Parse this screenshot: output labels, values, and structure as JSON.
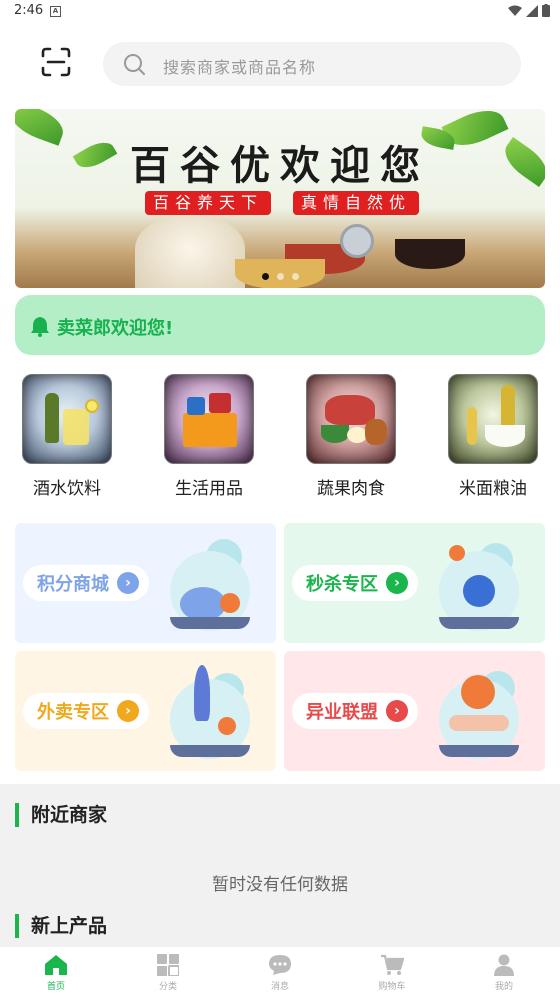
{
  "status_bar": {
    "time": "2:46"
  },
  "search": {
    "placeholder": "搜索商家或商品名称"
  },
  "banner": {
    "title": "百谷优欢迎您",
    "tag_left": "百谷养天下",
    "tag_right": "真情自然优",
    "slide_count": 3,
    "active_slide": 1
  },
  "notice": {
    "text": "卖菜郎欢迎您!"
  },
  "categories": [
    {
      "label": "酒水饮料",
      "icon": "drinks-icon"
    },
    {
      "label": "生活用品",
      "icon": "daily-goods-icon"
    },
    {
      "label": "蔬果肉食",
      "icon": "meat-produce-icon"
    },
    {
      "label": "米面粮油",
      "icon": "grain-oil-icon"
    }
  ],
  "promo_cards": [
    {
      "label": "积分商城",
      "color": "#7fa3e8",
      "bg": "#eef4ff",
      "icon": "piggy-bank-icon"
    },
    {
      "label": "秒杀专区",
      "color": "#1bb54e",
      "bg": "#e4f8ee",
      "icon": "stopwatch-icon"
    },
    {
      "label": "外卖专区",
      "color": "#f0a81c",
      "bg": "#fff5e4",
      "icon": "rocket-icon"
    },
    {
      "label": "异业联盟",
      "color": "#e84a4a",
      "bg": "#ffe7ea",
      "icon": "handshake-icon"
    }
  ],
  "sections": {
    "nearby_title": "附近商家",
    "nearby_empty": "暂时没有任何数据",
    "new_title": "新上产品"
  },
  "tabbar": [
    {
      "label": "首页",
      "icon": "home-icon",
      "active": true
    },
    {
      "label": "分类",
      "icon": "grid-icon",
      "active": false
    },
    {
      "label": "消息",
      "icon": "chat-icon",
      "active": false
    },
    {
      "label": "购物车",
      "icon": "cart-icon",
      "active": false
    },
    {
      "label": "我的",
      "icon": "user-icon",
      "active": false
    }
  ],
  "colors": {
    "accent": "#1bb54e",
    "notice_bg": "#b4eec7",
    "page_bg": "#f1f1f1"
  }
}
